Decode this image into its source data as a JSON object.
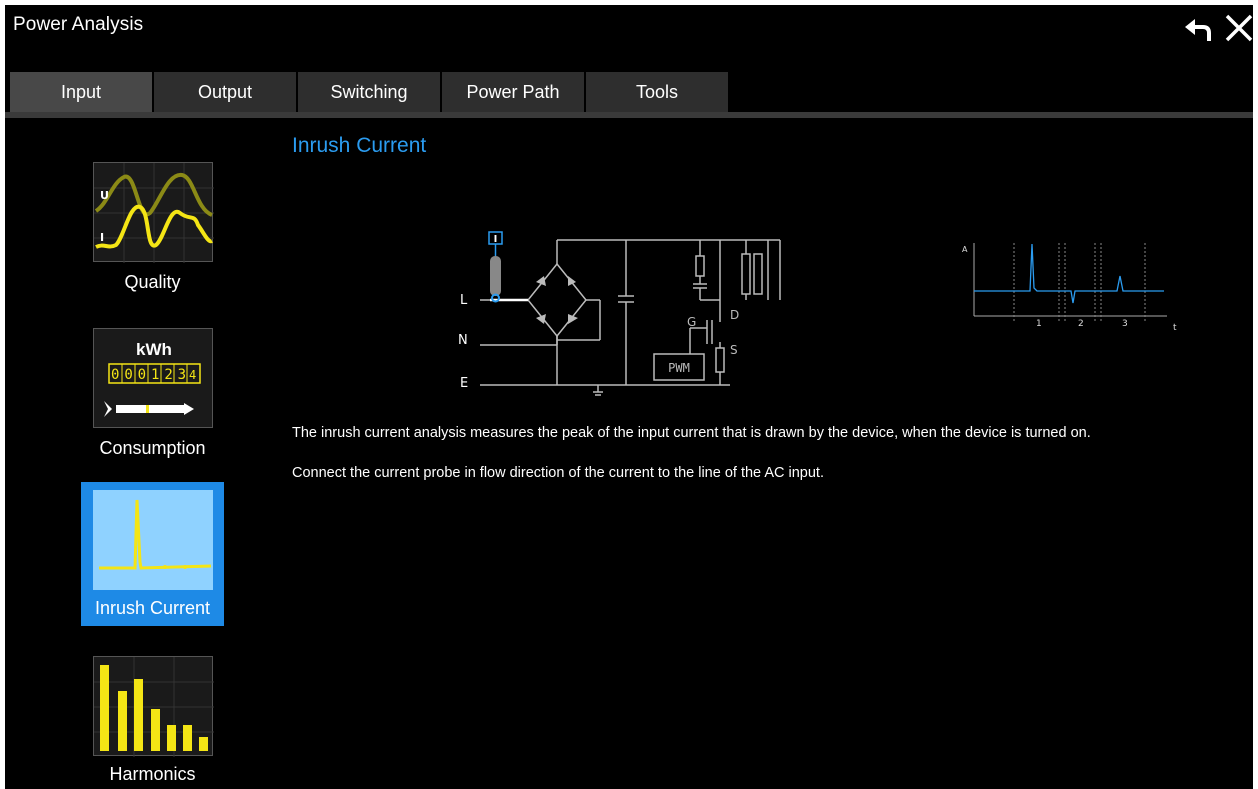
{
  "window": {
    "title": "Power Analysis"
  },
  "titlebar_icons": {
    "back": "undo-arrow-icon",
    "close": "close-x-icon"
  },
  "tabs": [
    {
      "label": "Input",
      "active": true
    },
    {
      "label": "Output",
      "active": false
    },
    {
      "label": "Switching",
      "active": false
    },
    {
      "label": "Power Path",
      "active": false
    },
    {
      "label": "Tools",
      "active": false
    }
  ],
  "sidebar": {
    "items": [
      {
        "label": "Quality",
        "selected": false,
        "thumb_text": {
          "u": "U",
          "i": "I"
        }
      },
      {
        "label": "Consumption",
        "selected": false,
        "thumb_text": {
          "unit": "kWh",
          "digits": "000123",
          "frac": "4"
        }
      },
      {
        "label": "Inrush Current",
        "selected": true
      },
      {
        "label": "Harmonics",
        "selected": false
      }
    ]
  },
  "content": {
    "title": "Inrush Current",
    "description_1": "The inrush current analysis measures the peak of the input current that is drawn by the device, when the device is turned on.",
    "description_2": "Connect the current probe in flow direction of the current to the line of the AC input."
  },
  "circuit": {
    "probe_label": "I",
    "line_labels": [
      "L",
      "N",
      "E"
    ],
    "pwm_label": "PWM",
    "g_label": "G",
    "d_label": "D",
    "s_label": "S"
  },
  "waveform": {
    "y_label": "A",
    "x_label": "t",
    "segments": [
      "1",
      "2",
      "3"
    ]
  },
  "colors": {
    "accent": "#2b9cf0",
    "selected_bg": "#1e8ae6",
    "tab_bg": "#2e2e2e",
    "tab_active": "#484848",
    "trace_yellow": "#f4e515",
    "trace_olive": "#8b8a16"
  }
}
